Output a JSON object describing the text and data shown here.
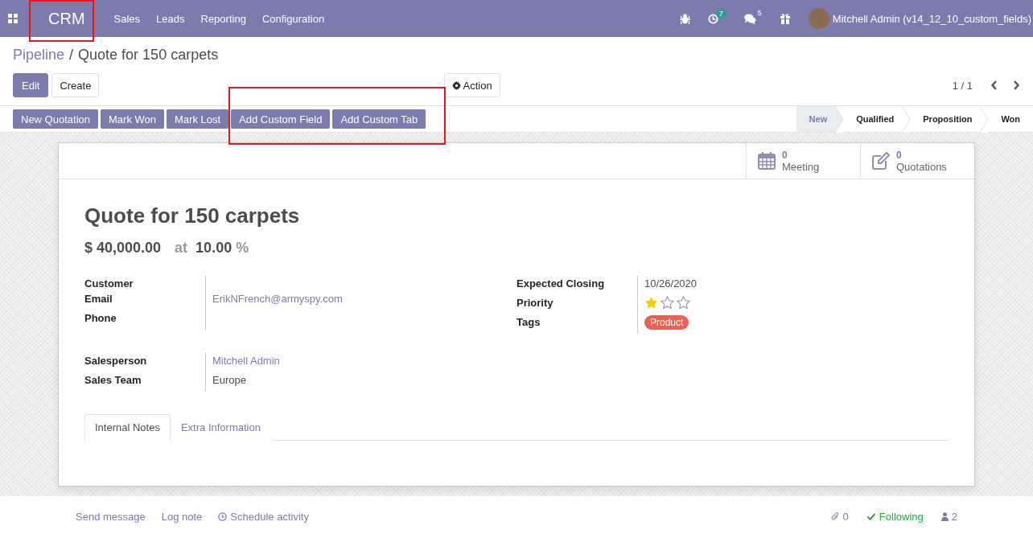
{
  "navbar": {
    "app_name": "CRM",
    "menu": [
      "Sales",
      "Leads",
      "Reporting",
      "Configuration"
    ],
    "activity_count": "7",
    "message_count": "5",
    "user": "Mitchell Admin (v14_12_10_custom_fields)"
  },
  "breadcrumb": {
    "parent": "Pipeline",
    "separator": "/",
    "current": "Quote for 150 carpets"
  },
  "buttons": [
    "Edit",
    "Create"
  ],
  "action_menu": "Action",
  "pager": "1 / 1",
  "header_buttons": [
    "New Quotation",
    "Mark Won",
    "Mark Lost",
    "Add Custom Field",
    "Add Custom Tab"
  ],
  "stages": [
    {
      "label": "New",
      "selected": true
    },
    {
      "label": "Qualified",
      "selected": false
    },
    {
      "label": "Proposition",
      "selected": false
    },
    {
      "label": "Won",
      "selected": false
    }
  ],
  "smart_buttons": [
    {
      "kind": "meeting",
      "count": "0",
      "label": "Meeting"
    },
    {
      "kind": "quotation",
      "count": "0",
      "label": "Quotations"
    }
  ],
  "title": "Quote for 150 carpets",
  "revenue": "$ 40,000.00",
  "at": "at",
  "probability": "10.00",
  "percent": "%",
  "left_group": [
    {
      "label": "Customer",
      "kind": "empty"
    },
    {
      "label": "Email",
      "kind": "link",
      "value": "ErikNFrench@armyspy.com"
    },
    {
      "label": "Phone",
      "kind": "empty"
    }
  ],
  "right_group": [
    {
      "label": "Expected Closing",
      "kind": "text",
      "value": "10/26/2020"
    },
    {
      "label": "Priority",
      "kind": "stars",
      "stars": 1
    },
    {
      "label": "Tags",
      "kind": "tags",
      "tags": [
        {
          "label": "Product",
          "color": "#f06050"
        }
      ]
    }
  ],
  "sales_group": [
    {
      "label": "Salesperson",
      "kind": "link",
      "value": "Mitchell Admin"
    },
    {
      "label": "Sales Team",
      "kind": "text",
      "value": "Europe"
    }
  ],
  "notebook_tabs": [
    {
      "label": "Internal Notes",
      "selected": true
    },
    {
      "label": "Extra Information",
      "selected": false
    }
  ],
  "chatter": {
    "actions": [
      "Send message",
      "Log note",
      "Schedule activity"
    ],
    "attachments": "0",
    "following": "Following",
    "followers": "2"
  }
}
